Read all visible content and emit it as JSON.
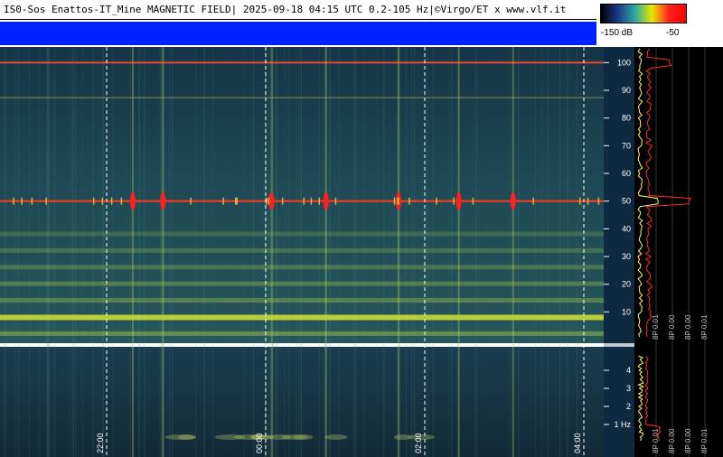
{
  "header": {
    "title": "IS0-Sos Enattos-IT_Mine MAGNETIC FIELD| 2025-09-18 04:15 UTC 0.2-105 Hz|©Virgo/ET x www.vlf.it"
  },
  "legend": {
    "min_label": "-150 dB",
    "max_label": "-50",
    "colors": [
      "#000000",
      "#1b3a8a",
      "#2aa8a0",
      "#e8e800",
      "#ff2020",
      "#ff0000"
    ]
  },
  "chart_data": {
    "type": "heatmap",
    "title": "IS0-Sos Enattos-IT_Mine MAGNETIC FIELD| 2025-09-18 04:15 UTC 0.2-105 Hz|©Virgo/ET x www.vlf.it",
    "x_ticks": [
      "22:00",
      "00:00",
      "02:00",
      "04:00"
    ],
    "upper_panel": {
      "y_ticks": [
        10,
        20,
        30,
        40,
        50,
        60,
        70,
        80,
        90,
        100
      ],
      "ylim": [
        0,
        105
      ],
      "lines_hz": [
        50,
        100,
        87.5
      ],
      "harmonic_bands_hz": [
        2,
        8,
        14,
        20,
        26,
        32,
        38
      ]
    },
    "lower_panel": {
      "y_ticks": [
        "1 Hz",
        "2",
        "3",
        "4"
      ],
      "ylim": [
        0,
        5
      ]
    },
    "spectrum_scale_labels": [
      "8P 0.01",
      "8P 0.00",
      "8P 0.00",
      "8P 0.01"
    ],
    "spectrum_scale_labels_lower": [
      "8P 0.01",
      "8P 0.00",
      "8P 0.00",
      "8P 0.01"
    ],
    "bursts_x": [
      0.22,
      0.27,
      0.45,
      0.54,
      0.66,
      0.76,
      0.85
    ],
    "legend_range_db": [
      -150,
      -50
    ]
  }
}
